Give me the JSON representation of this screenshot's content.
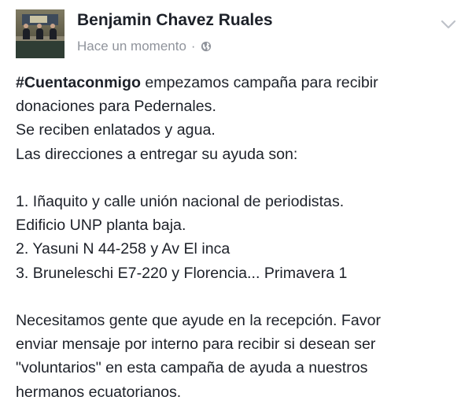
{
  "post": {
    "author": "Benjamin Chavez Ruales",
    "timestamp": "Hace un momento",
    "separator": "·",
    "privacy_icon": "globe-icon",
    "menu_icon": "chevron-down-icon",
    "hashtag": "#Cuentaconmigo",
    "line1_rest": " empezamos campaña para recibir",
    "line2": "donaciones para Pedernales.",
    "line3": "Se reciben enlatados y agua.",
    "line4": "Las direcciones a entregar su ayuda son:",
    "addresses": [
      "1.  Iñaquito y calle unión nacional de periodistas.",
      "Edificio UNP planta baja.",
      "2.  Yasuni N 44-258 y Av El inca",
      "3.  Bruneleschi E7-220 y Florencia... Primavera 1"
    ],
    "closing": [
      "Necesitamos gente que ayude en la recepción. Favor",
      "enviar mensaje por interno para recibir si desean ser",
      "\"voluntarios\" en esta campaña de ayuda a nuestros",
      "hermanos ecuatorianos."
    ]
  },
  "colors": {
    "text": "#1d2129",
    "meta": "#90949c",
    "background": "#ffffff"
  }
}
